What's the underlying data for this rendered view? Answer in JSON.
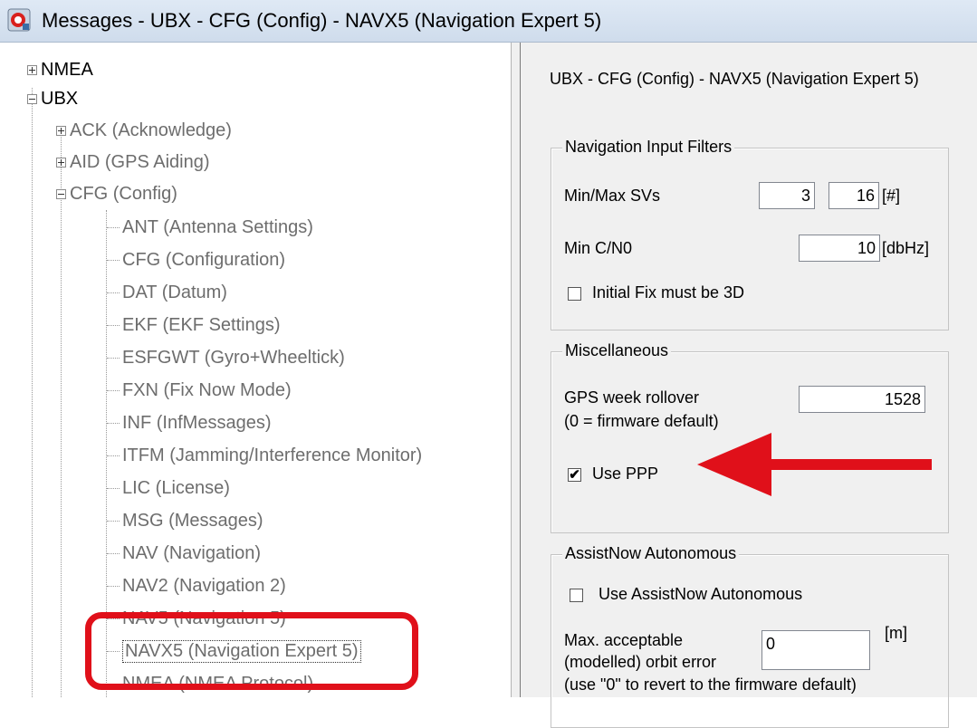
{
  "window": {
    "title": "Messages - UBX - CFG (Config) - NAVX5 (Navigation Expert 5)",
    "icon": "u-center-app-icon"
  },
  "tree": {
    "nmea": "NMEA",
    "ubx": "UBX",
    "ack": "ACK (Acknowledge)",
    "aid": "AID (GPS Aiding)",
    "cfg": "CFG (Config)",
    "cfg_items": [
      "ANT (Antenna Settings)",
      "CFG (Configuration)",
      "DAT (Datum)",
      "EKF (EKF Settings)",
      "ESFGWT (Gyro+Wheeltick)",
      "FXN (Fix Now Mode)",
      "INF (InfMessages)",
      "ITFM (Jamming/Interference Monitor)",
      "LIC (License)",
      "MSG (Messages)",
      "NAV (Navigation)",
      "NAV2 (Navigation 2)",
      "NAV5 (Navigation 5)",
      "NAVX5 (Navigation Expert 5)",
      "NMEA (NMEA Protocol)"
    ],
    "selected": "NAVX5 (Navigation Expert 5)"
  },
  "panel": {
    "heading": "UBX - CFG (Config) - NAVX5 (Navigation Expert 5)",
    "nav_filters": {
      "title": "Navigation Input Filters",
      "min_max_svs_label": "Min/Max SVs",
      "min_svs": "3",
      "max_svs": "16",
      "svs_unit": "[#]",
      "min_cn0_label": "Min C/N0",
      "min_cn0": "10",
      "cn0_unit": "[dbHz]",
      "initial_fix_3d_label": "Initial Fix must be 3D",
      "initial_fix_3d_checked": false
    },
    "misc": {
      "title": "Miscellaneous",
      "gps_week_label": "GPS week rollover",
      "gps_week_note": "(0 = firmware default)",
      "gps_week_value": "1528",
      "use_ppp_label": "Use PPP",
      "use_ppp_checked": true
    },
    "assistnow": {
      "title": "AssistNow Autonomous",
      "use_label": "Use AssistNow Autonomous",
      "use_checked": false,
      "max_err_label_1": "Max. acceptable",
      "max_err_label_2": "(modelled) orbit error",
      "max_err_value": "0",
      "max_err_unit": "[m]",
      "hint": "(use \"0\" to revert to the firmware default)"
    }
  },
  "annotations": {
    "highlight_color": "#e0101a",
    "arrow_color": "#e0101a"
  }
}
